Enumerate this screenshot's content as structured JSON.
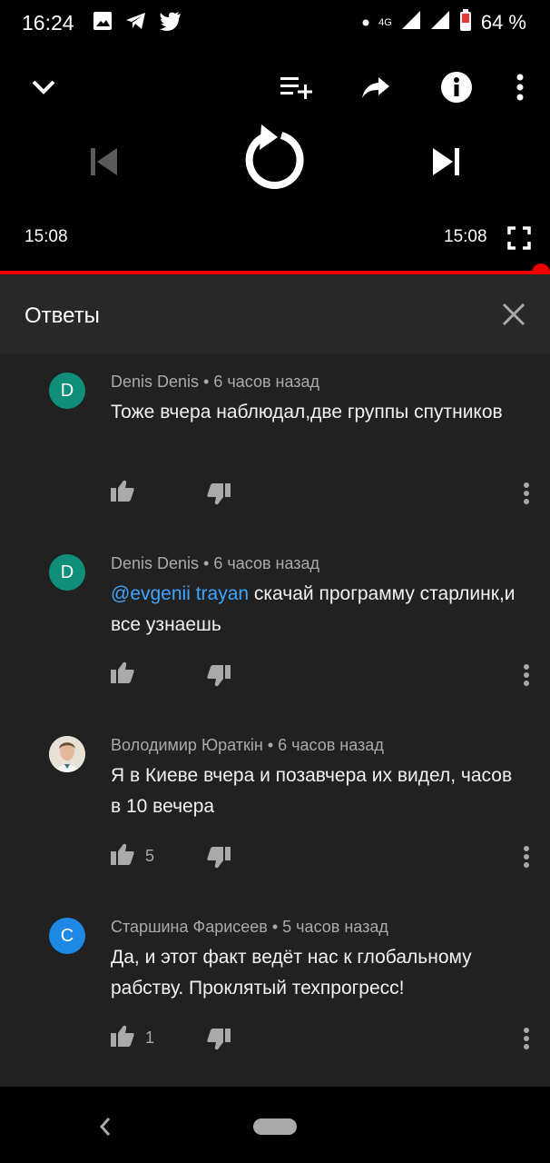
{
  "status_bar": {
    "time": "16:24",
    "network": "4G",
    "battery": "64 %"
  },
  "player": {
    "current_time": "15:08",
    "duration": "15:08",
    "progress": 1.0
  },
  "replies": {
    "title": "Ответы"
  },
  "comments": [
    {
      "avatar_letter": "D",
      "avatar_color": "#0f8f7a",
      "author": "Denis Denis",
      "age": "6 часов назад",
      "mention": "",
      "text": "Тоже вчера наблюдал,две группы спутников",
      "likes": ""
    },
    {
      "avatar_letter": "D",
      "avatar_color": "#0f8f7a",
      "author": "Denis Denis",
      "age": "6 часов назад",
      "mention": "@evgenii trayan",
      "text": " скачай программу старлинк,и все узнаешь",
      "likes": ""
    },
    {
      "avatar_letter": "",
      "avatar_color": "#d9d0c1",
      "author": "Володимир Юраткін",
      "age": "6 часов назад",
      "mention": "",
      "text": "Я в Киеве вчера и позавчера их видел, часов в 10 вечера",
      "likes": "5"
    },
    {
      "avatar_letter": "С",
      "avatar_color": "#1e88e5",
      "author": "Старшина Фарисеев",
      "age": "5 часов назад",
      "mention": "",
      "text": "Да, и этот факт ведёт нас к глобальному рабству. Проклятый техпрогресс!",
      "likes": "1"
    }
  ],
  "colors": {
    "accent": "#ff0000",
    "mention": "#3ea6ff",
    "sheet_bg": "#212121",
    "header_bg": "#282828"
  },
  "icons": [
    "image-icon",
    "telegram-icon",
    "twitter-icon",
    "signal-icon",
    "battery-icon",
    "chevron-down-icon",
    "add-to-queue-icon",
    "share-icon",
    "info-icon",
    "more-vert-icon",
    "skip-previous-icon",
    "replay-icon",
    "skip-next-icon",
    "fullscreen-icon",
    "close-icon",
    "thumb-up-icon",
    "thumb-down-icon",
    "back-icon",
    "home-pill-icon"
  ]
}
